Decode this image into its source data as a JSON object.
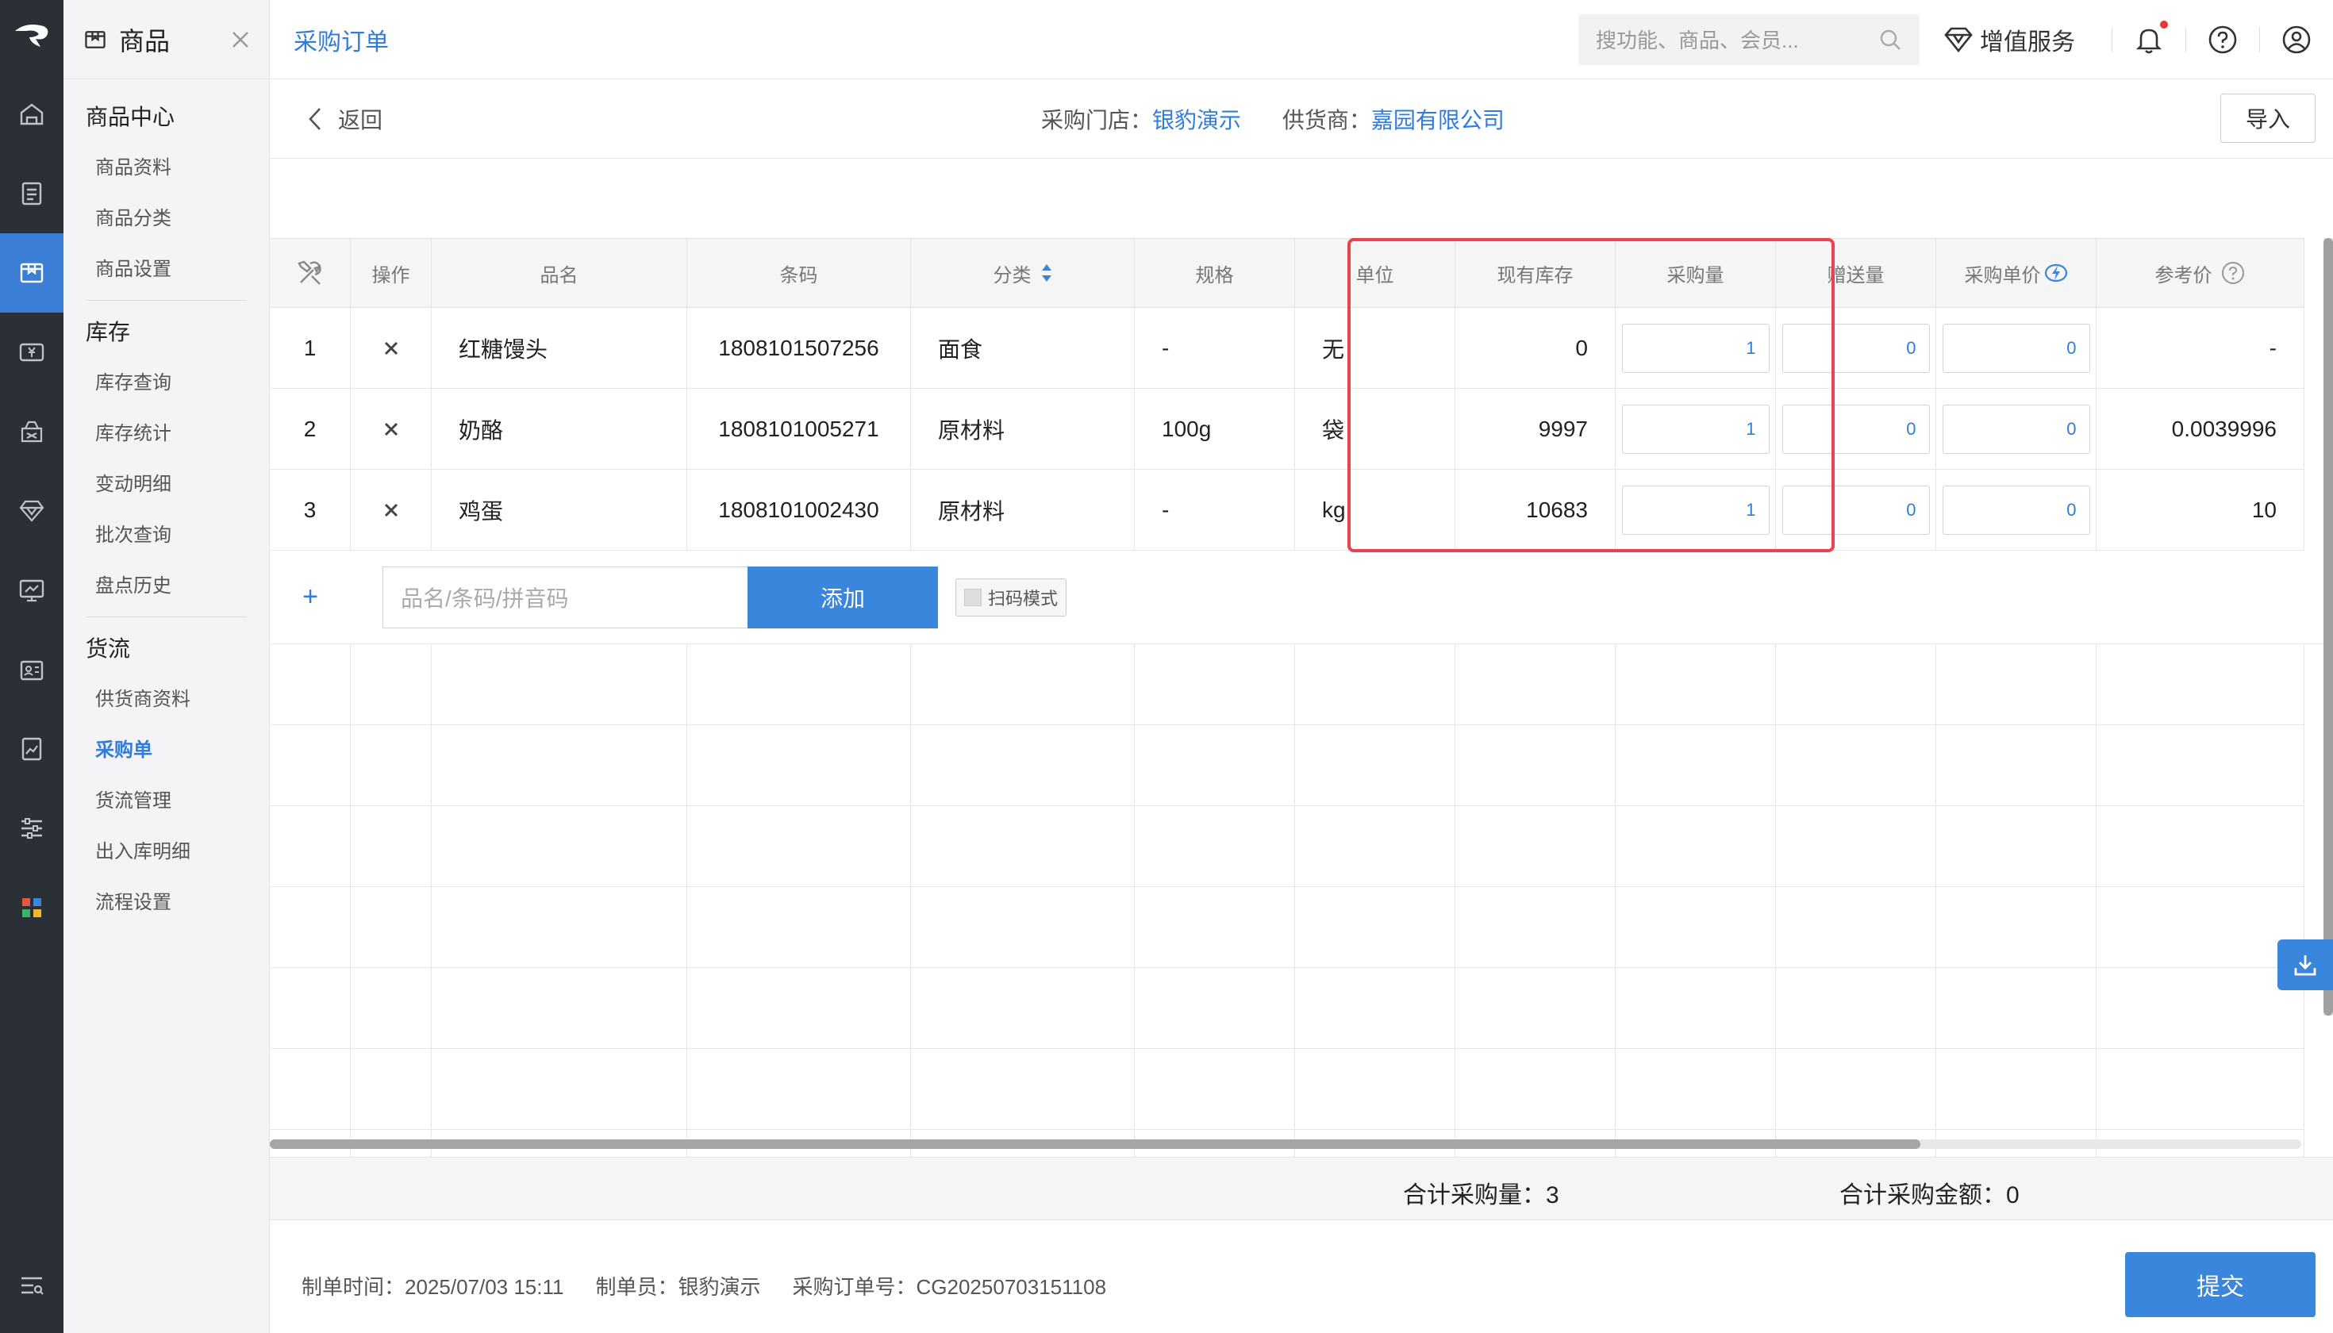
{
  "sidebar": {
    "title": "商品",
    "groups": [
      {
        "label": "商品中心",
        "items": [
          "商品资料",
          "商品分类",
          "商品设置"
        ]
      },
      {
        "label": "库存",
        "items": [
          "库存查询",
          "库存统计",
          "变动明细",
          "批次查询",
          "盘点历史"
        ]
      },
      {
        "label": "货流",
        "items": [
          "供货商资料",
          "采购单",
          "货流管理",
          "出入库明细",
          "流程设置"
        ]
      }
    ],
    "active_item": "采购单"
  },
  "header": {
    "title": "采购订单",
    "search_placeholder": "搜功能、商品、会员...",
    "value_added": "增值服务"
  },
  "subbar": {
    "back": "返回",
    "store_label": "采购门店：",
    "store_value": "银豹演示",
    "supplier_label": "供货商：",
    "supplier_value": "嘉园有限公司",
    "import": "导入"
  },
  "table": {
    "columns": [
      "操作",
      "品名",
      "条码",
      "分类",
      "规格",
      "单位",
      "现有库存",
      "采购量",
      "赠送量",
      "采购单价",
      "参考价"
    ],
    "rows": [
      {
        "no": "1",
        "name": "红糖馒头",
        "barcode": "1808101507256",
        "category": "面食",
        "spec": "-",
        "unit": "无",
        "stock": "0",
        "qty": "1",
        "gift": "0",
        "price": "0",
        "ref": "-"
      },
      {
        "no": "2",
        "name": "奶酪",
        "barcode": "1808101005271",
        "category": "原材料",
        "spec": "100g",
        "unit": "袋",
        "stock": "9997",
        "qty": "1",
        "gift": "0",
        "price": "0",
        "ref": "0.0039996"
      },
      {
        "no": "3",
        "name": "鸡蛋",
        "barcode": "1808101002430",
        "category": "原材料",
        "spec": "-",
        "unit": "kg",
        "stock": "10683",
        "qty": "1",
        "gift": "0",
        "price": "0",
        "ref": "10"
      }
    ],
    "add_placeholder": "品名/条码/拼音码",
    "add_button": "添加",
    "scan_mode": "扫码模式",
    "add_icon": "+"
  },
  "summary": {
    "total_qty": "合计采购量：3",
    "total_amount": "合计采购金额：0"
  },
  "footer": {
    "created_time": "制单时间：2025/07/03 15:11",
    "creator": "制单员：银豹演示",
    "order_no": "采购订单号：CG20250703151108",
    "submit": "提交"
  },
  "colors": {
    "accent": "#2f7cdc",
    "highlight": "#e8434e",
    "rail": "#2b2f36"
  }
}
